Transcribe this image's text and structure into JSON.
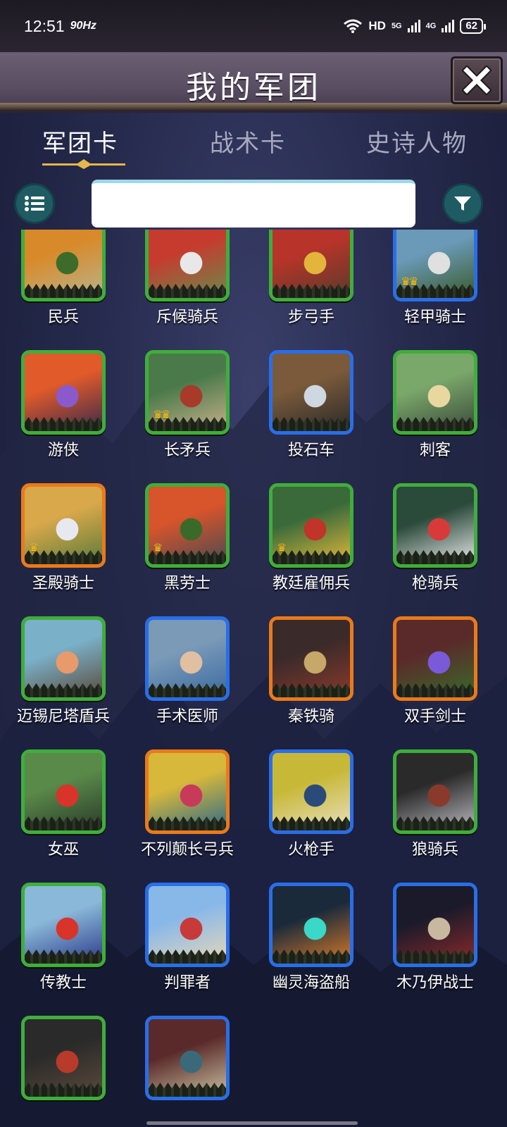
{
  "status_bar": {
    "time": "12:51",
    "refresh": "90Hz",
    "network": "HD",
    "signal1": "5G",
    "signal2": "4G",
    "battery": "62"
  },
  "header": {
    "title": "我的军团",
    "close_icon": "close-x-icon"
  },
  "tabs": [
    {
      "label": "军团卡",
      "active": true
    },
    {
      "label": "战术卡",
      "active": false
    },
    {
      "label": "史诗人物",
      "active": false
    }
  ],
  "toolbar": {
    "list_icon": "list-icon",
    "filter_icon": "filter-icon",
    "search_value": "",
    "search_placeholder": ""
  },
  "colors": {
    "rarity_green": "#3fae3a",
    "rarity_blue": "#2a6ee8",
    "rarity_orange": "#ea7a1a",
    "accent_teal": "#1f5b63"
  },
  "cards": [
    {
      "name": "民兵",
      "rarity": "green",
      "crowns": 0,
      "palette": [
        "#d88a2a",
        "#3d6b2a",
        "#b9b38a"
      ]
    },
    {
      "name": "斥候骑兵",
      "rarity": "green",
      "crowns": 0,
      "palette": [
        "#c63b2e",
        "#e8e8e8",
        "#6a8a4a"
      ]
    },
    {
      "name": "步弓手",
      "rarity": "green",
      "crowns": 0,
      "palette": [
        "#b8342a",
        "#e3b53a",
        "#5a3a2a"
      ]
    },
    {
      "name": "轻甲骑士",
      "rarity": "blue",
      "crowns": 2,
      "palette": [
        "#6a9ab8",
        "#e0e0e0",
        "#3a5a2a"
      ]
    },
    {
      "name": "游侠",
      "rarity": "green",
      "crowns": 0,
      "palette": [
        "#e05a2a",
        "#8a5acd",
        "#3a2a4a"
      ]
    },
    {
      "name": "长矛兵",
      "rarity": "green",
      "crowns": 2,
      "palette": [
        "#4a7a4a",
        "#a83a2a",
        "#c8b08a"
      ]
    },
    {
      "name": "投石车",
      "rarity": "blue",
      "crowns": 0,
      "palette": [
        "#7a5a3a",
        "#cfd8e0",
        "#2a2a2a"
      ]
    },
    {
      "name": "刺客",
      "rarity": "green",
      "crowns": 0,
      "palette": [
        "#7aa86a",
        "#e8d8a0",
        "#3a4a3a"
      ]
    },
    {
      "name": "圣殿骑士",
      "rarity": "orange",
      "crowns": 1,
      "palette": [
        "#d8a84a",
        "#e8e8f0",
        "#5a7a3a"
      ]
    },
    {
      "name": "黑劳士",
      "rarity": "green",
      "crowns": 1,
      "palette": [
        "#d8542a",
        "#3a6a2a",
        "#4a4a52"
      ]
    },
    {
      "name": "教廷雇佣兵",
      "rarity": "green",
      "crowns": 1,
      "palette": [
        "#3a6a3a",
        "#c0342a",
        "#e0b83a"
      ]
    },
    {
      "name": "枪骑兵",
      "rarity": "green",
      "crowns": 0,
      "palette": [
        "#2a4a3a",
        "#d83a3a",
        "#e8e8e8"
      ]
    },
    {
      "name": "迈锡尼塔盾兵",
      "rarity": "green",
      "crowns": 0,
      "palette": [
        "#7ab0c8",
        "#e89a6a",
        "#5a4a3a"
      ]
    },
    {
      "name": "手术医师",
      "rarity": "blue",
      "crowns": 0,
      "palette": [
        "#7a9ab8",
        "#e0c0a0",
        "#3a6aa0"
      ]
    },
    {
      "name": "秦铁骑",
      "rarity": "orange",
      "crowns": 0,
      "palette": [
        "#3a2a2a",
        "#c8a868",
        "#8a3a2a"
      ]
    },
    {
      "name": "双手剑士",
      "rarity": "orange",
      "crowns": 0,
      "palette": [
        "#5a2a2a",
        "#7a5ad8",
        "#3a6a2a"
      ]
    },
    {
      "name": "女巫",
      "rarity": "green",
      "crowns": 0,
      "palette": [
        "#5a8a4a",
        "#d8342a",
        "#2a3a2a"
      ]
    },
    {
      "name": "不列颠长弓兵",
      "rarity": "orange",
      "crowns": 0,
      "palette": [
        "#d8b83a",
        "#c83a5a",
        "#2a6a8a"
      ]
    },
    {
      "name": "火枪手",
      "rarity": "blue",
      "crowns": 0,
      "palette": [
        "#c8b838",
        "#2a4a7a",
        "#e8e0c0"
      ]
    },
    {
      "name": "狼骑兵",
      "rarity": "green",
      "crowns": 0,
      "palette": [
        "#2a2a2a",
        "#8a3a2a",
        "#b8b8c0"
      ]
    },
    {
      "name": "传教士",
      "rarity": "green",
      "crowns": 0,
      "palette": [
        "#8ab8d8",
        "#d8342a",
        "#2a3a8a"
      ]
    },
    {
      "name": "判罪者",
      "rarity": "blue",
      "crowns": 0,
      "palette": [
        "#88b8e8",
        "#c83a3a",
        "#e8d8b8"
      ]
    },
    {
      "name": "幽灵海盗船",
      "rarity": "blue",
      "crowns": 0,
      "palette": [
        "#1a2a3a",
        "#3ad8c8",
        "#d87a2a"
      ]
    },
    {
      "name": "木乃伊战士",
      "rarity": "blue",
      "crowns": 0,
      "palette": [
        "#1a1a2a",
        "#c8b8a0",
        "#8a2a2a"
      ]
    },
    {
      "name": "",
      "rarity": "green",
      "crowns": 0,
      "palette": [
        "#2a2a2a",
        "#b83a2a",
        "#5a4a3a"
      ]
    },
    {
      "name": "",
      "rarity": "blue",
      "crowns": 0,
      "palette": [
        "#5a2a2a",
        "#3a6a7a",
        "#c8c0a0"
      ]
    }
  ]
}
